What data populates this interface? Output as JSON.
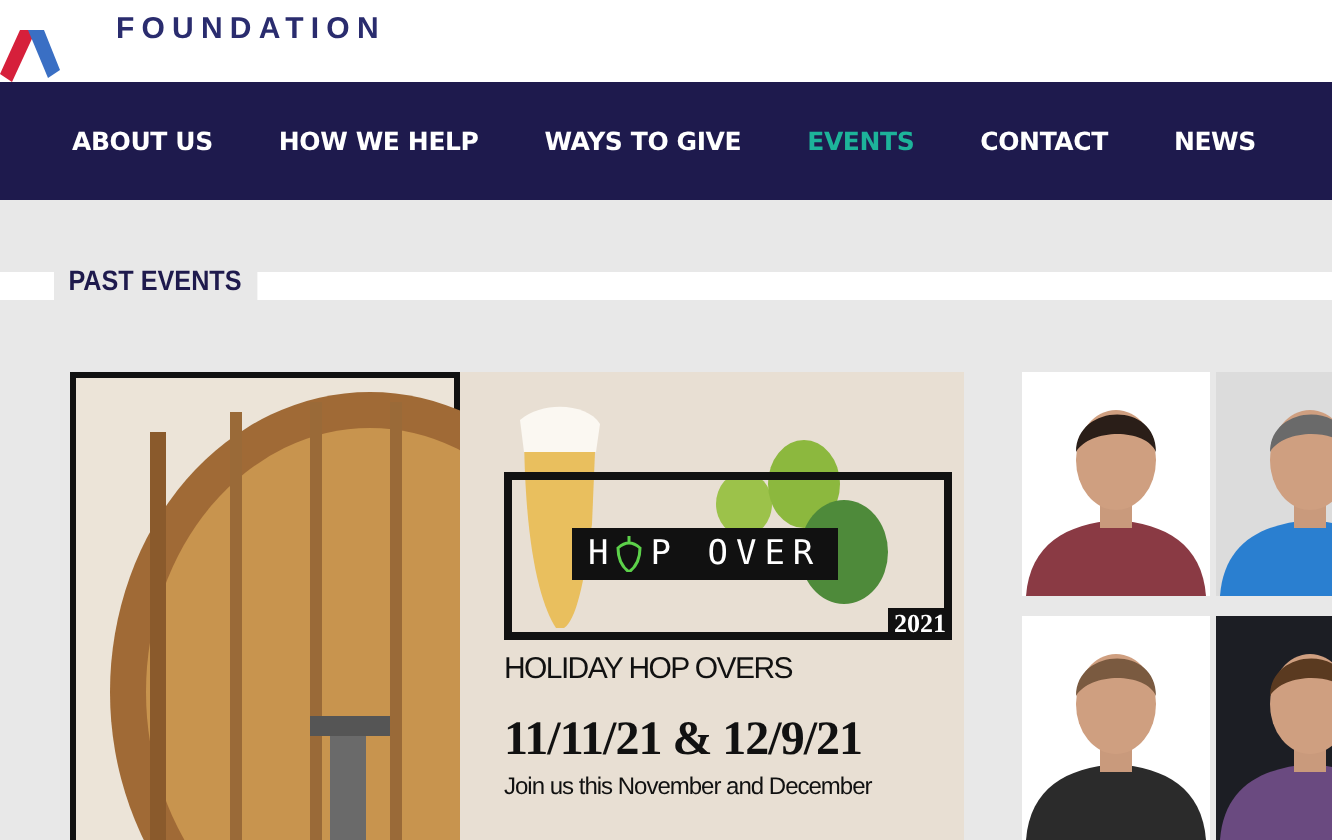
{
  "header": {
    "logo_text": "FOUNDATION"
  },
  "nav": [
    {
      "label": "ABOUT US",
      "selected": false
    },
    {
      "label": "HOW WE HELP",
      "selected": false
    },
    {
      "label": "WAYS TO GIVE",
      "selected": false
    },
    {
      "label": "EVENTS",
      "selected": true
    },
    {
      "label": "CONTACT",
      "selected": false
    },
    {
      "label": "NEWS",
      "selected": false
    }
  ],
  "section": {
    "title": "PAST EVENTS"
  },
  "poster": {
    "logo_parts": [
      "H",
      "P OVER"
    ],
    "year": "2021",
    "name": "HOLIDAY HOP OVERS",
    "dates": "11/11/21 & 12/9/21",
    "tagline": "Join us this November and December"
  }
}
